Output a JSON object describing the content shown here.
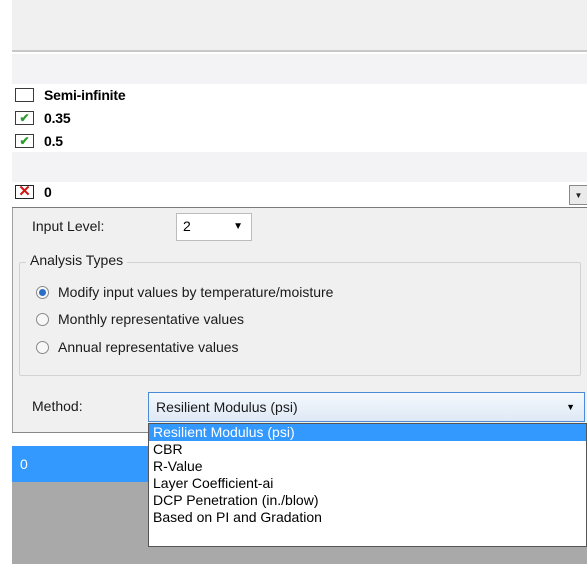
{
  "layers": {
    "rows": [
      {
        "label": "Semi-infinite",
        "state": "unchecked"
      },
      {
        "label": "0.35",
        "state": "checked"
      },
      {
        "label": "0.5",
        "state": "checked"
      }
    ],
    "selected_row": {
      "label": "0",
      "state": "cross"
    }
  },
  "icons": {
    "check": "✔",
    "cross": "✕",
    "arrow": "▼"
  },
  "input_level": {
    "label": "Input Level:",
    "value": "2"
  },
  "analysis_types": {
    "title": "Analysis Types",
    "options": [
      {
        "label": "Modify input values by temperature/moisture",
        "selected": true
      },
      {
        "label": "Monthly representative values",
        "selected": false
      },
      {
        "label": "Annual representative values",
        "selected": false
      }
    ]
  },
  "method": {
    "label": "Method:",
    "value": "Resilient Modulus (psi)",
    "options": [
      "Resilient Modulus (psi)",
      "CBR",
      "R-Value",
      "Layer Coefficient-ai",
      "DCP Penetration (in./blow)",
      "Based on PI and Gradation"
    ],
    "highlighted_index": 0
  },
  "value_list": {
    "selected_value": "0"
  },
  "colors": {
    "highlight": "#3399ff",
    "check_green": "#2e9b2e",
    "cross_red": "#d01515",
    "panel_bg": "#f0f0f0"
  }
}
